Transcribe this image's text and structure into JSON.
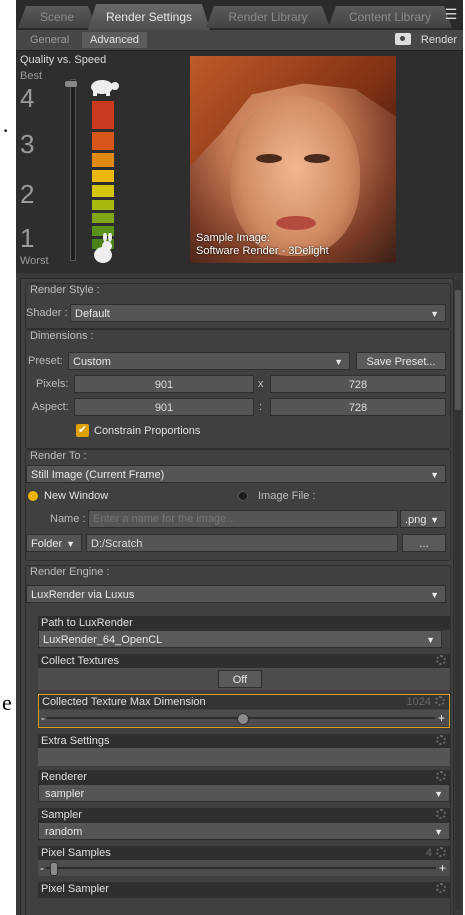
{
  "tabs": [
    {
      "label": "Scene"
    },
    {
      "label": "Render Settings"
    },
    {
      "label": "Render Library"
    },
    {
      "label": "Content Library"
    }
  ],
  "subtabs": {
    "general": "General",
    "advanced": "Advanced",
    "render": "Render"
  },
  "quality": {
    "title": "Quality vs. Speed",
    "best": "Best",
    "worst": "Worst",
    "levels": [
      "4",
      "3",
      "2",
      "1"
    ],
    "bar_colors": [
      "#c93a1e",
      "#d8561a",
      "#e08a12",
      "#e9b80f",
      "#d4c40b",
      "#a9b80c",
      "#7fa514",
      "#5a9117",
      "#4b8119"
    ]
  },
  "preview": {
    "caption_line1": "Sample Image:",
    "caption_line2": "Software Render - 3Delight"
  },
  "render_style": {
    "header": "Render Style :",
    "shader_label": "Shader :",
    "shader_value": "Default"
  },
  "dimensions": {
    "header": "Dimensions :",
    "preset_label": "Preset:",
    "preset_value": "Custom",
    "save_preset": "Save Preset...",
    "pixels_label": "Pixels:",
    "pixels_w": "901",
    "pixels_sep": "x",
    "pixels_h": "728",
    "aspect_label": "Aspect:",
    "aspect_w": "901",
    "aspect_sep": ":",
    "aspect_h": "728",
    "constrain": "Constrain Proportions",
    "constrain_checked": true
  },
  "render_to": {
    "header": "Render To :",
    "target": "Still Image (Current Frame)",
    "new_window": "New Window",
    "image_file": "Image File :",
    "name_label": "Name :",
    "name_placeholder": "Enter a name for the image...",
    "format": ".png",
    "folder_label": "Folder",
    "folder_path": "D:/Scratch",
    "browse": "..."
  },
  "render_engine": {
    "header": "Render Engine :",
    "engine": "LuxRender via Luxus",
    "path_label": "Path to LuxRender",
    "path_value": "LuxRender_64_OpenCL",
    "collect_label": "Collect Textures",
    "collect_value": "Off",
    "max_dim_label": "Collected Texture Max Dimension",
    "max_dim_value": "1024",
    "extra_label": "Extra Settings",
    "renderer_label": "Renderer",
    "renderer_value": "sampler",
    "sampler_label": "Sampler",
    "sampler_value": "random",
    "pixel_samples_label": "Pixel Samples",
    "pixel_samples_value": "4",
    "pixel_sampler_label": "Pixel Sampler"
  }
}
